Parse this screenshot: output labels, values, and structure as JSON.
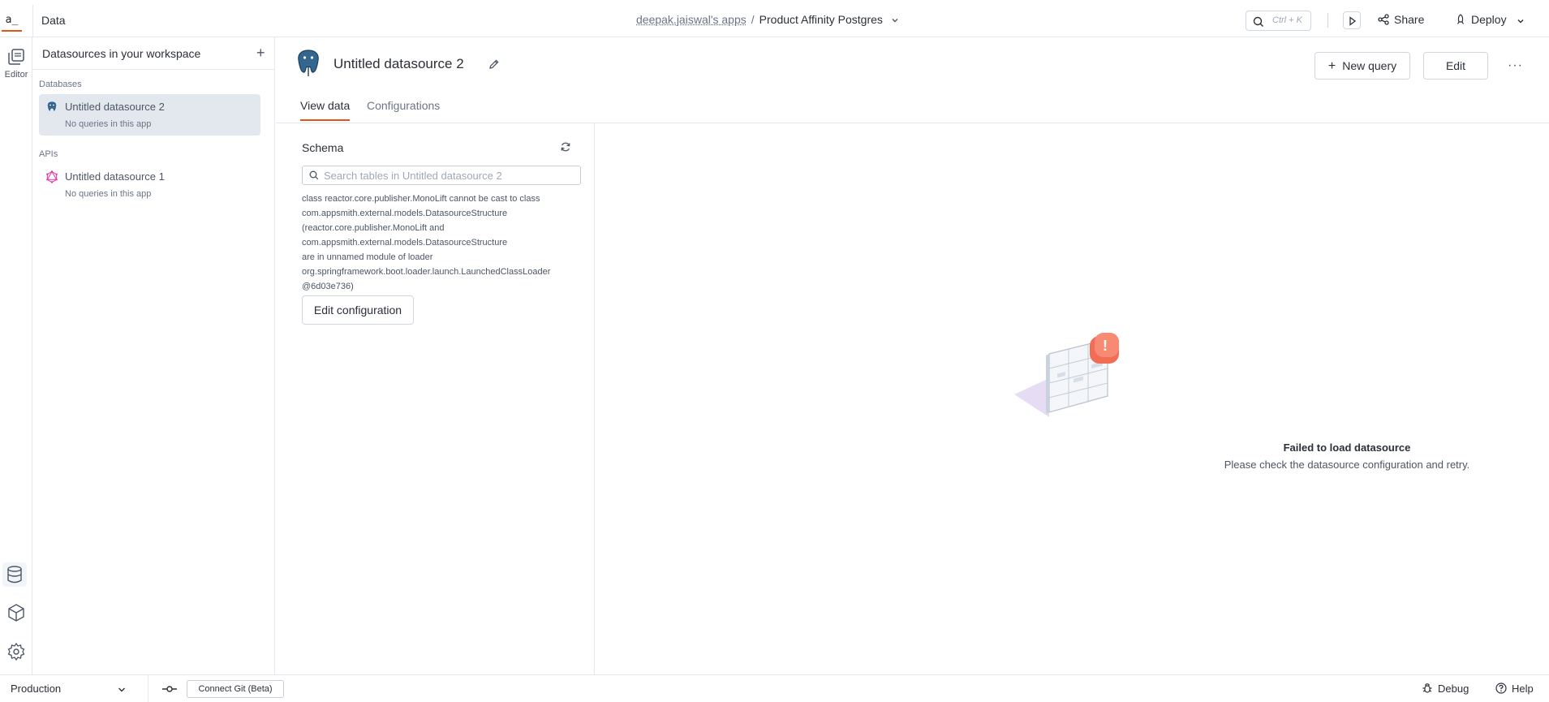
{
  "header": {
    "logo_text": "a_",
    "section_title": "Data",
    "workspace": "deepak.jaiswal's apps",
    "breadcrumb_sep": "/",
    "app_name": "Product Affinity Postgres",
    "search_shortcut": "Ctrl + K",
    "share_label": "Share",
    "deploy_label": "Deploy"
  },
  "rail": {
    "editor_label": "Editor"
  },
  "sidebar": {
    "title": "Datasources in your workspace",
    "add_icon": "+",
    "groups": [
      {
        "label": "Databases",
        "items": [
          {
            "name": "Untitled datasource 2",
            "subtitle": "No queries in this app",
            "icon": "postgres-icon"
          }
        ]
      },
      {
        "label": "APIs",
        "items": [
          {
            "name": "Untitled datasource 1",
            "subtitle": "No queries in this app",
            "icon": "graphql-icon"
          }
        ]
      }
    ]
  },
  "main": {
    "datasource_title": "Untitled datasource 2",
    "new_query_label": "New query",
    "edit_label": "Edit",
    "more_label": "···",
    "tabs": [
      {
        "label": "View data",
        "active": true
      },
      {
        "label": "Configurations",
        "active": false
      }
    ]
  },
  "schema": {
    "title": "Schema",
    "search_placeholder": "Search tables in Untitled datasource 2",
    "error_lines": [
      "class reactor.core.publisher.MonoLift cannot be cast to class",
      "com.appsmith.external.models.DatasourceStructure",
      "(reactor.core.publisher.MonoLift and",
      "com.appsmith.external.models.DatasourceStructure",
      "are in unnamed module of loader",
      "org.springframework.boot.loader.launch.LaunchedClassLoader",
      "@6d03e736)"
    ],
    "edit_config_label": "Edit configuration"
  },
  "empty_state": {
    "title": "Failed to load datasource",
    "message": "Please check the datasource configuration and retry.",
    "badge": "!"
  },
  "bottom": {
    "environment": "Production",
    "connect_git_label": "Connect Git (Beta)",
    "debug_label": "Debug",
    "help_label": "Help"
  },
  "colors": {
    "accent": "#e15615",
    "active_item_bg": "#e3e8ef",
    "error_badge": "#f26d55"
  }
}
